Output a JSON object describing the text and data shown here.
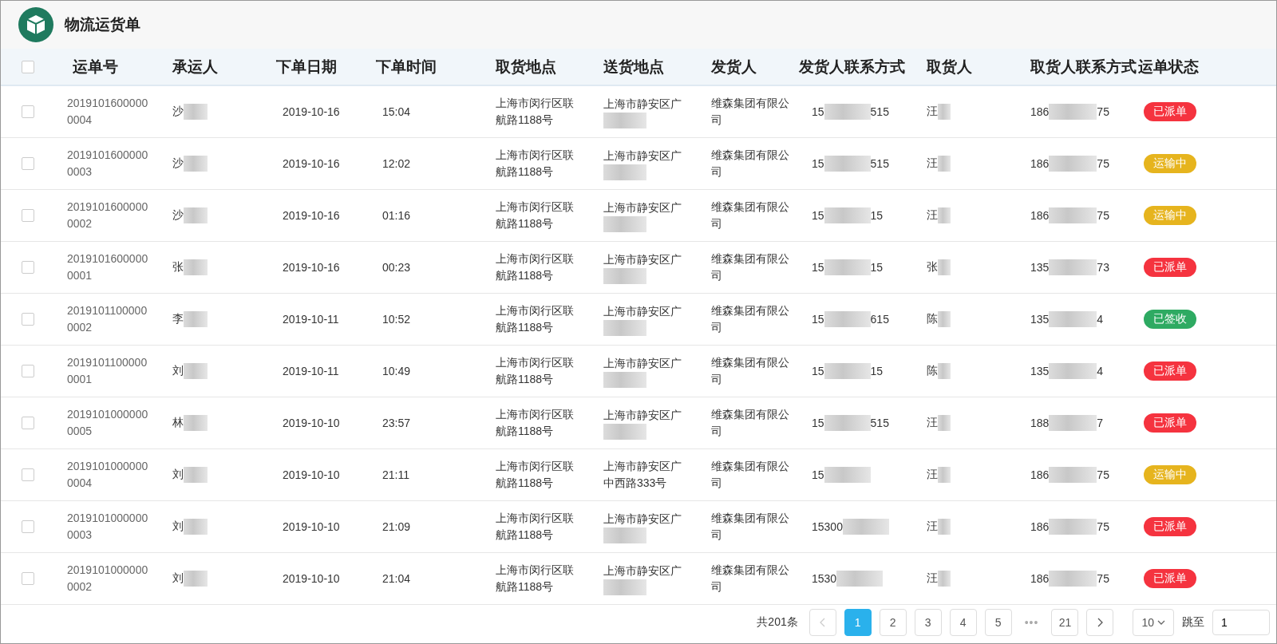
{
  "app": {
    "title": "物流运货单"
  },
  "table": {
    "select_all": {
      "checked": false
    },
    "columns": [
      "运单号",
      "承运人",
      "下单日期",
      "下单时间",
      "取货地点",
      "送货地点",
      "发货人",
      "发货人联系方式",
      "取货人",
      "取货人联系方式",
      "运单状态"
    ],
    "rows": [
      {
        "checked": false,
        "id": [
          "2019101600000",
          "0004"
        ],
        "carrier": "沙",
        "date": "2019-10-16",
        "time": "15:04",
        "pickup": [
          "上海市闵行区联",
          "航路1188号"
        ],
        "delivery": [
          "上海市静安区广"
        ],
        "shipper": [
          "维森集团有限公",
          "司"
        ],
        "shipper_phone": {
          "start": "15",
          "end": "515"
        },
        "receiver": "汪",
        "receiver_phone": {
          "start": "186",
          "end": "75"
        },
        "status": {
          "label": "已派单",
          "color": "#f5333f"
        }
      },
      {
        "checked": false,
        "id": [
          "2019101600000",
          "0003"
        ],
        "carrier": "沙",
        "date": "2019-10-16",
        "time": "12:02",
        "pickup": [
          "上海市闵行区联",
          "航路1188号"
        ],
        "delivery": [
          "上海市静安区广"
        ],
        "shipper": [
          "维森集团有限公",
          "司"
        ],
        "shipper_phone": {
          "start": "15",
          "end": "515"
        },
        "receiver": "汪",
        "receiver_phone": {
          "start": "186",
          "end": "75"
        },
        "status": {
          "label": "运输中",
          "color": "#e6b41e"
        }
      },
      {
        "checked": false,
        "id": [
          "2019101600000",
          "0002"
        ],
        "carrier": "沙",
        "date": "2019-10-16",
        "time": "01:16",
        "pickup": [
          "上海市闵行区联",
          "航路1188号"
        ],
        "delivery": [
          "上海市静安区广"
        ],
        "shipper": [
          "维森集团有限公",
          "司"
        ],
        "shipper_phone": {
          "start": "15",
          "end": "15"
        },
        "receiver": "汪",
        "receiver_phone": {
          "start": "186",
          "end": "75"
        },
        "status": {
          "label": "运输中",
          "color": "#e6b41e"
        }
      },
      {
        "checked": false,
        "id": [
          "2019101600000",
          "0001"
        ],
        "carrier": "张",
        "date": "2019-10-16",
        "time": "00:23",
        "pickup": [
          "上海市闵行区联",
          "航路1188号"
        ],
        "delivery": [
          "上海市静安区广"
        ],
        "shipper": [
          "维森集团有限公",
          "司"
        ],
        "shipper_phone": {
          "start": "15",
          "end": "15"
        },
        "receiver": "张",
        "receiver_phone": {
          "start": "135",
          "end": "73"
        },
        "status": {
          "label": "已派单",
          "color": "#f5333f"
        }
      },
      {
        "checked": false,
        "id": [
          "2019101100000",
          "0002"
        ],
        "carrier": "李",
        "date": "2019-10-11",
        "time": "10:52",
        "pickup": [
          "上海市闵行区联",
          "航路1188号"
        ],
        "delivery": [
          "上海市静安区广"
        ],
        "shipper": [
          "维森集团有限公",
          "司"
        ],
        "shipper_phone": {
          "start": "15",
          "end": "615"
        },
        "receiver": "陈",
        "receiver_phone": {
          "start": "135",
          "end": "4"
        },
        "status": {
          "label": "已签收",
          "color": "#2eaa62"
        }
      },
      {
        "checked": false,
        "id": [
          "2019101100000",
          "0001"
        ],
        "carrier": "刘",
        "date": "2019-10-11",
        "time": "10:49",
        "pickup": [
          "上海市闵行区联",
          "航路1188号"
        ],
        "delivery": [
          "上海市静安区广"
        ],
        "shipper": [
          "维森集团有限公",
          "司"
        ],
        "shipper_phone": {
          "start": "15",
          "end": "15"
        },
        "receiver": "陈",
        "receiver_phone": {
          "start": "135",
          "end": "4"
        },
        "status": {
          "label": "已派单",
          "color": "#f5333f"
        }
      },
      {
        "checked": false,
        "id": [
          "2019101000000",
          "0005"
        ],
        "carrier": "林",
        "date": "2019-10-10",
        "time": "23:57",
        "pickup": [
          "上海市闵行区联",
          "航路1188号"
        ],
        "delivery": [
          "上海市静安区广"
        ],
        "shipper": [
          "维森集团有限公",
          "司"
        ],
        "shipper_phone": {
          "start": "15",
          "end": "515"
        },
        "receiver": "汪",
        "receiver_phone": {
          "start": "188",
          "end": "7"
        },
        "status": {
          "label": "已派单",
          "color": "#f5333f"
        }
      },
      {
        "checked": false,
        "id": [
          "2019101000000",
          "0004"
        ],
        "carrier": "刘",
        "date": "2019-10-10",
        "time": "21:11",
        "pickup": [
          "上海市闵行区联",
          "航路1188号"
        ],
        "delivery": [
          "上海市静安区广",
          "中西路333号"
        ],
        "shipper": [
          "维森集团有限公",
          "司"
        ],
        "shipper_phone": {
          "start": "15"
        },
        "receiver": "汪",
        "receiver_phone": {
          "start": "186",
          "end": "75"
        },
        "status": {
          "label": "运输中",
          "color": "#e6b41e"
        }
      },
      {
        "checked": false,
        "id": [
          "2019101000000",
          "0003"
        ],
        "carrier": "刘",
        "date": "2019-10-10",
        "time": "21:09",
        "pickup": [
          "上海市闵行区联",
          "航路1188号"
        ],
        "delivery": [
          "上海市静安区广"
        ],
        "shipper": [
          "维森集团有限公",
          "司"
        ],
        "shipper_phone": {
          "start": "15300"
        },
        "receiver": "汪",
        "receiver_phone": {
          "start": "186",
          "end": "75"
        },
        "status": {
          "label": "已派单",
          "color": "#f5333f"
        }
      },
      {
        "checked": false,
        "id": [
          "2019101000000",
          "0002"
        ],
        "carrier": "刘",
        "date": "2019-10-10",
        "time": "21:04",
        "pickup": [
          "上海市闵行区联",
          "航路1188号"
        ],
        "delivery": [
          "上海市静安区广"
        ],
        "shipper": [
          "维森集团有限公",
          "司"
        ],
        "shipper_phone": {
          "start": "1530"
        },
        "receiver": "汪",
        "receiver_phone": {
          "start": "186",
          "end": "75"
        },
        "status": {
          "label": "已派单",
          "color": "#f5333f"
        }
      }
    ]
  },
  "pagination": {
    "total": "共201条",
    "prev": {
      "disabled": true
    },
    "pages": [
      {
        "kind": "page",
        "label": "1",
        "selected": true
      },
      {
        "kind": "page",
        "label": "2",
        "selected": false
      },
      {
        "kind": "page",
        "label": "3",
        "selected": false
      },
      {
        "kind": "page",
        "label": "4",
        "selected": false
      },
      {
        "kind": "page",
        "label": "5",
        "selected": false
      },
      {
        "kind": "ellipsis",
        "label": "•••"
      },
      {
        "kind": "page",
        "label": "21",
        "selected": false
      }
    ],
    "next": {
      "disabled": false
    },
    "page_size": "10",
    "jump_label": "跳至",
    "jump_value": "1"
  }
}
